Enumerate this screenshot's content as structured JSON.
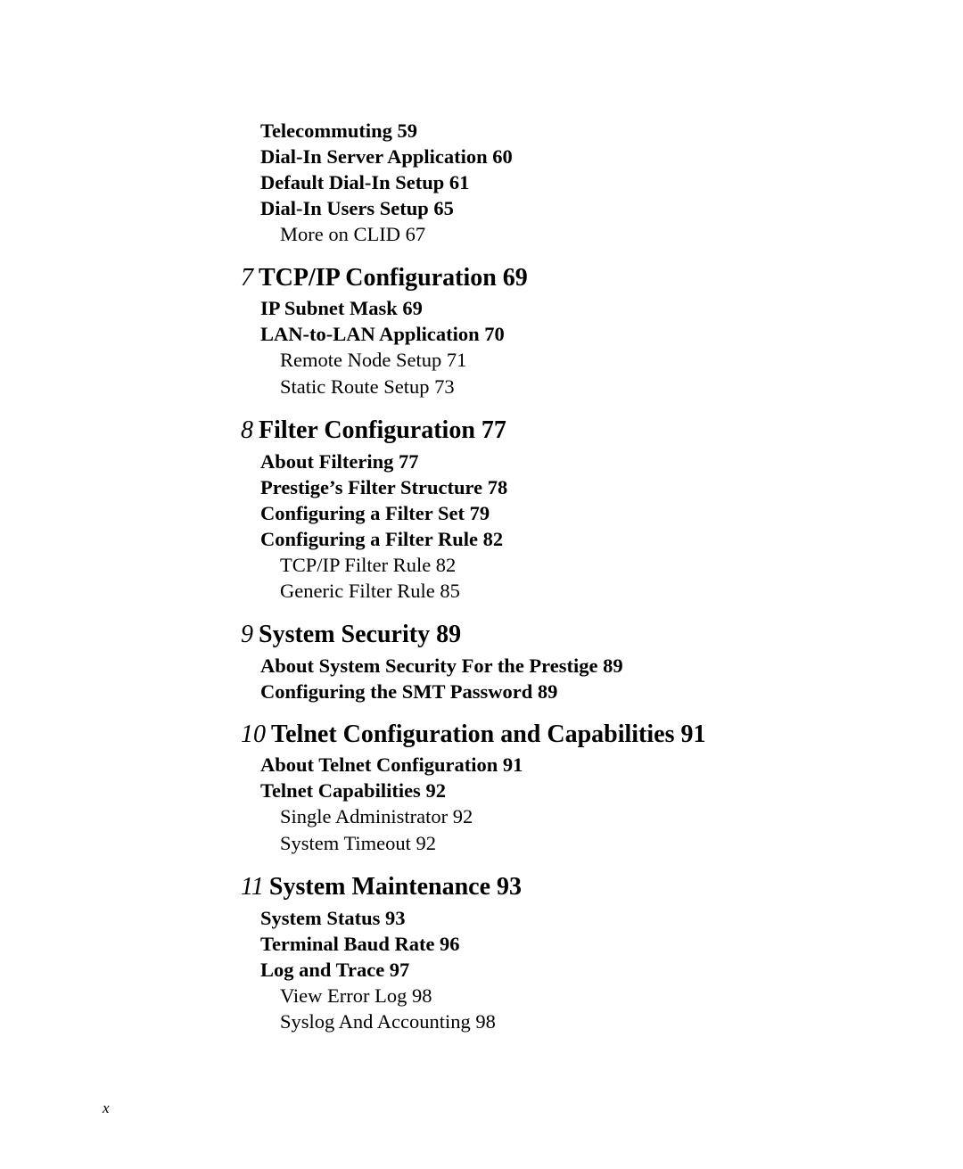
{
  "toc": {
    "carryover": [
      {
        "level": 2,
        "text": "Telecommuting 59"
      },
      {
        "level": 2,
        "text": "Dial-In Server Application 60"
      },
      {
        "level": 2,
        "text": "Default Dial-In Setup 61"
      },
      {
        "level": 2,
        "text": "Dial-In Users Setup 65"
      },
      {
        "level": 3,
        "text": "More on CLID 67"
      }
    ],
    "chapters": [
      {
        "number": "7",
        "title": "TCP/IP Configuration 69",
        "entries": [
          {
            "level": 2,
            "text": "IP Subnet Mask 69"
          },
          {
            "level": 2,
            "text": "LAN-to-LAN Application 70"
          },
          {
            "level": 3,
            "text": "Remote Node Setup 71"
          },
          {
            "level": 3,
            "text": "Static Route Setup 73"
          }
        ]
      },
      {
        "number": "8",
        "title": "Filter Configuration 77",
        "entries": [
          {
            "level": 2,
            "text": "About Filtering 77"
          },
          {
            "level": 2,
            "text": "Prestige’s Filter Structure 78"
          },
          {
            "level": 2,
            "text": "Configuring a Filter Set 79"
          },
          {
            "level": 2,
            "text": "Configuring a Filter Rule 82"
          },
          {
            "level": 3,
            "text": "TCP/IP Filter Rule 82"
          },
          {
            "level": 3,
            "text": "Generic Filter Rule 85"
          }
        ]
      },
      {
        "number": "9",
        "title": "System Security 89",
        "entries": [
          {
            "level": 2,
            "text": "About System Security For the Prestige 89"
          },
          {
            "level": 2,
            "text": "Configuring the SMT Password 89"
          }
        ]
      },
      {
        "number": "10",
        "title": "Telnet Configuration and Capabilities 91",
        "entries": [
          {
            "level": 2,
            "text": "About Telnet Configuration 91"
          },
          {
            "level": 2,
            "text": "Telnet Capabilities 92"
          },
          {
            "level": 3,
            "text": "Single Administrator 92"
          },
          {
            "level": 3,
            "text": "System Timeout 92"
          }
        ]
      },
      {
        "number": "11",
        "title": "System Maintenance 93",
        "entries": [
          {
            "level": 2,
            "text": "System Status 93"
          },
          {
            "level": 2,
            "text": "Terminal Baud Rate 96"
          },
          {
            "level": 2,
            "text": "Log and Trace 97"
          },
          {
            "level": 3,
            "text": "View Error Log 98"
          },
          {
            "level": 3,
            "text": "Syslog And Accounting 98"
          }
        ]
      }
    ]
  },
  "page_number": "x"
}
